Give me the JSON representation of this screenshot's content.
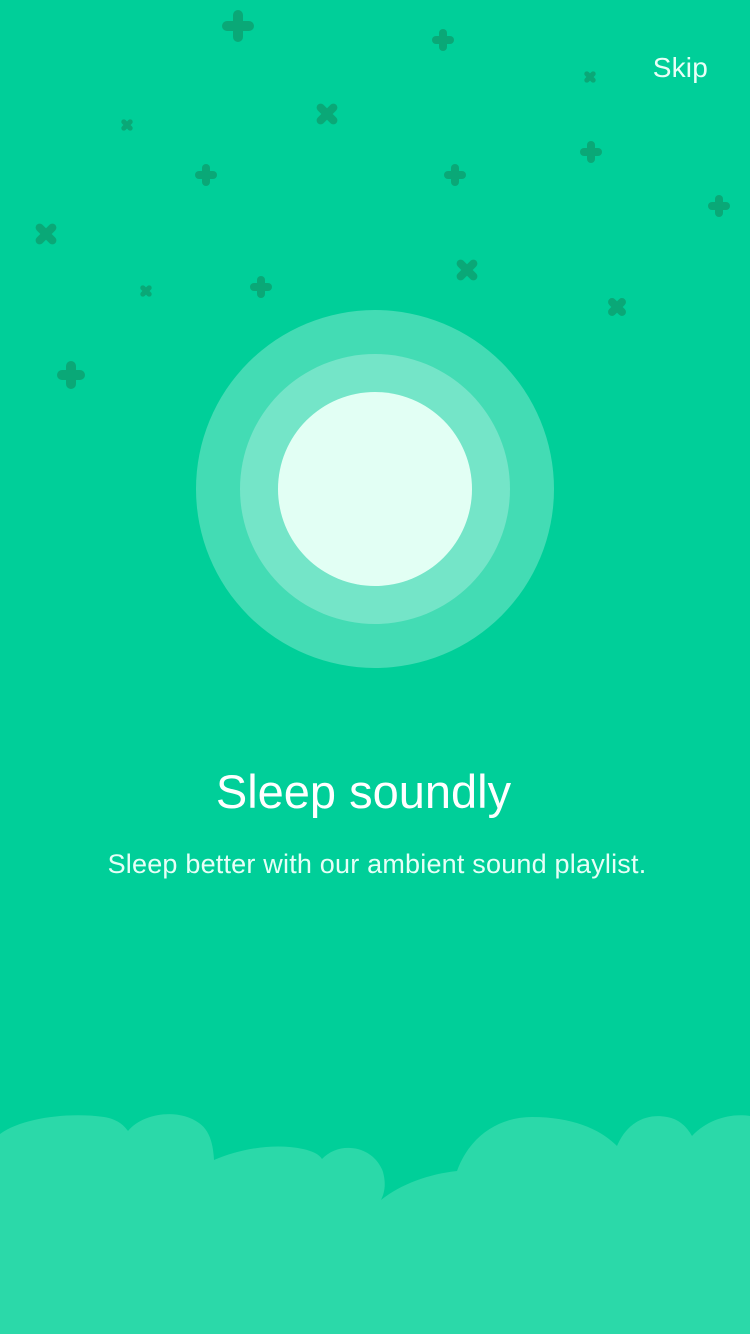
{
  "header": {
    "skip_label": "Skip"
  },
  "onboarding": {
    "title": "Sleep soundly",
    "description": "Sleep better with our ambient sound playlist."
  },
  "colors": {
    "background": "#00cf99",
    "star": "#0aa877",
    "moon_outer": "#43dcb4",
    "moon_middle": "#74e5c8",
    "moon_core": "#e2fff4",
    "cloud": "#2bd9a9"
  },
  "decorations": {
    "stars_icon": "plus-star-icon",
    "moon_icon": "moon-icon",
    "cloud_icon": "cloud-icon"
  }
}
